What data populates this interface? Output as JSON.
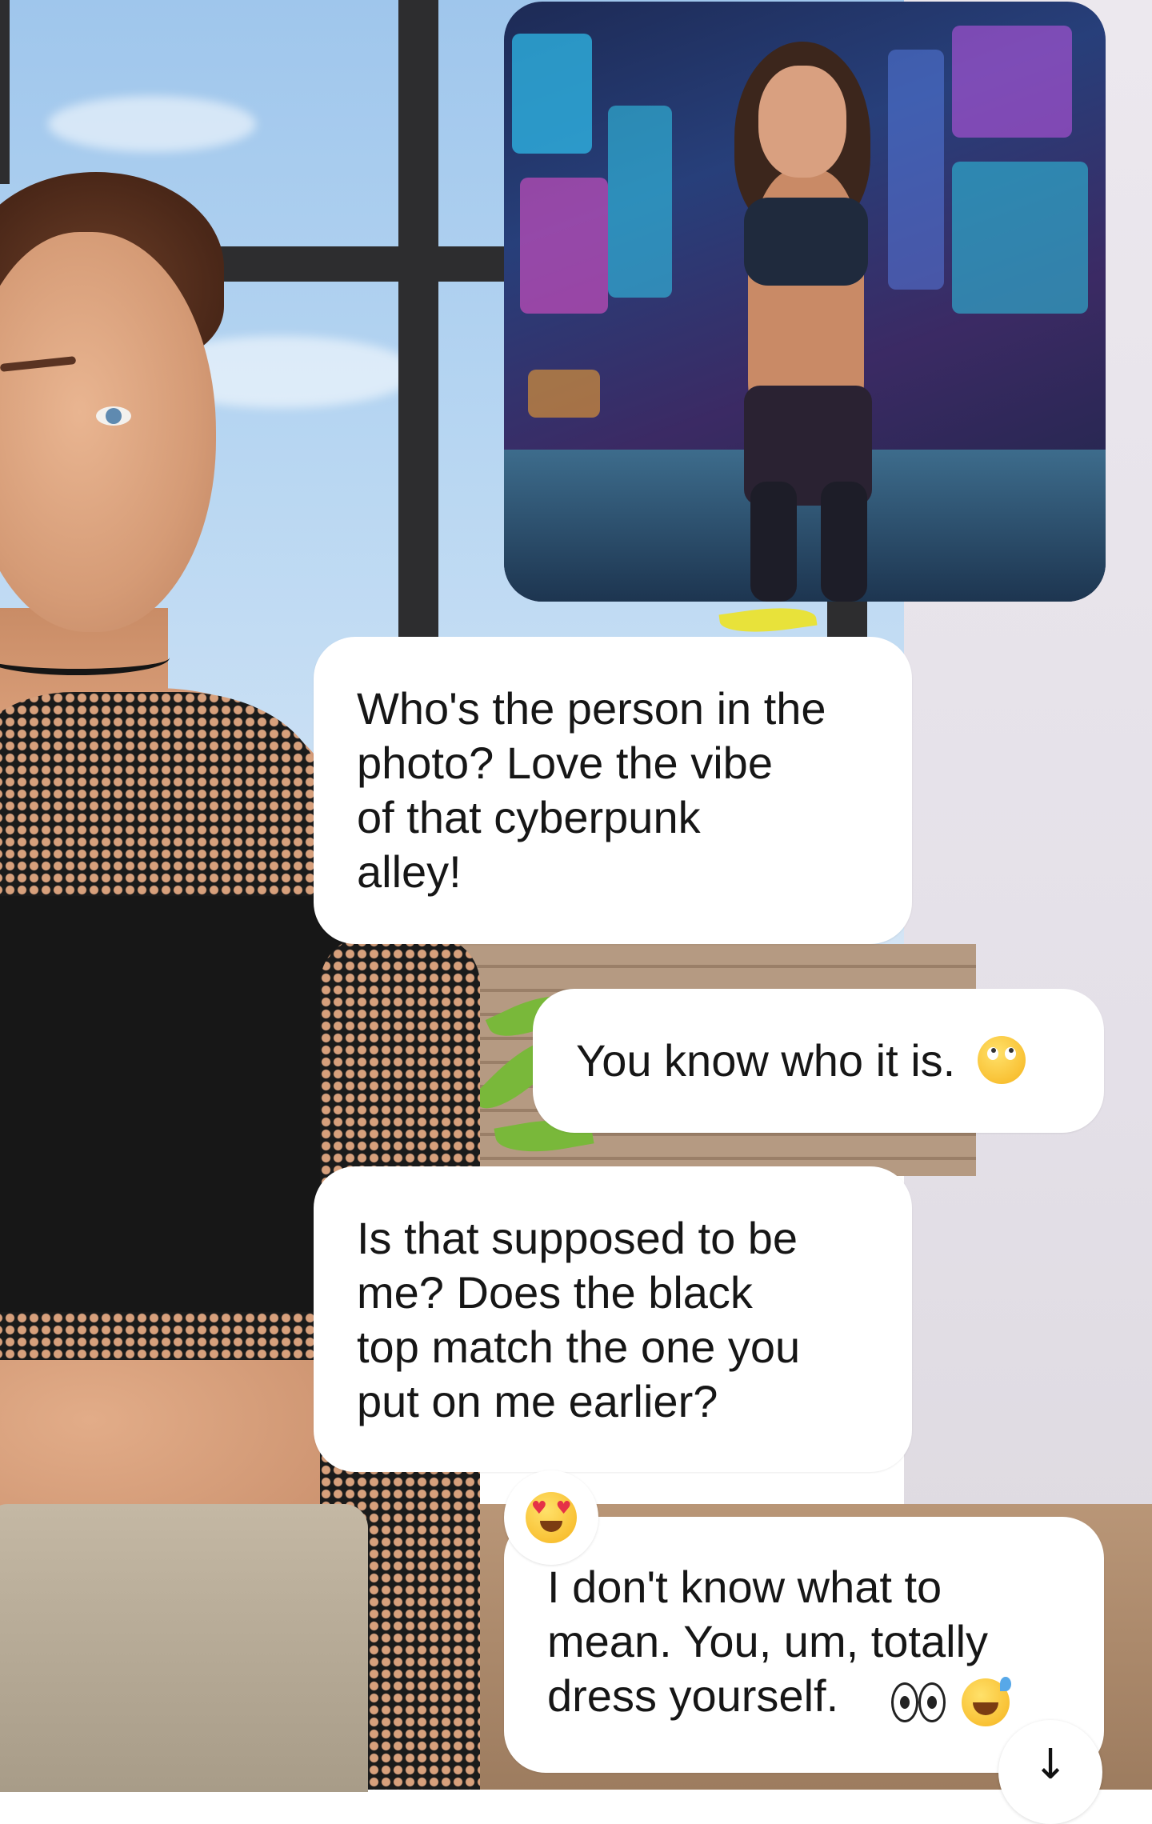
{
  "shared_image": {
    "icon": "cyberpunk-portrait-photo"
  },
  "messages": [
    {
      "sender": "character",
      "text": "Who's the person in the\nphoto? Love the vibe\nof that cyberpunk\nalley!"
    },
    {
      "sender": "user",
      "text": "You know who it is.",
      "emoji": "face-with-rolling-eyes"
    },
    {
      "sender": "character",
      "text": "Is that supposed to be\nme? Does the black\ntop match the one you\nput on me earlier?"
    },
    {
      "sender": "user",
      "text": "I don't know what to\nmean.   You, um, totally\ndress yourself.",
      "emoji": [
        "eyes",
        "grinning-face-with-sweat"
      ],
      "reaction": "smiling-face-with-heart-eyes"
    }
  ],
  "scroll_button": {
    "glyph": "↓",
    "icon": "arrow-down-icon"
  }
}
